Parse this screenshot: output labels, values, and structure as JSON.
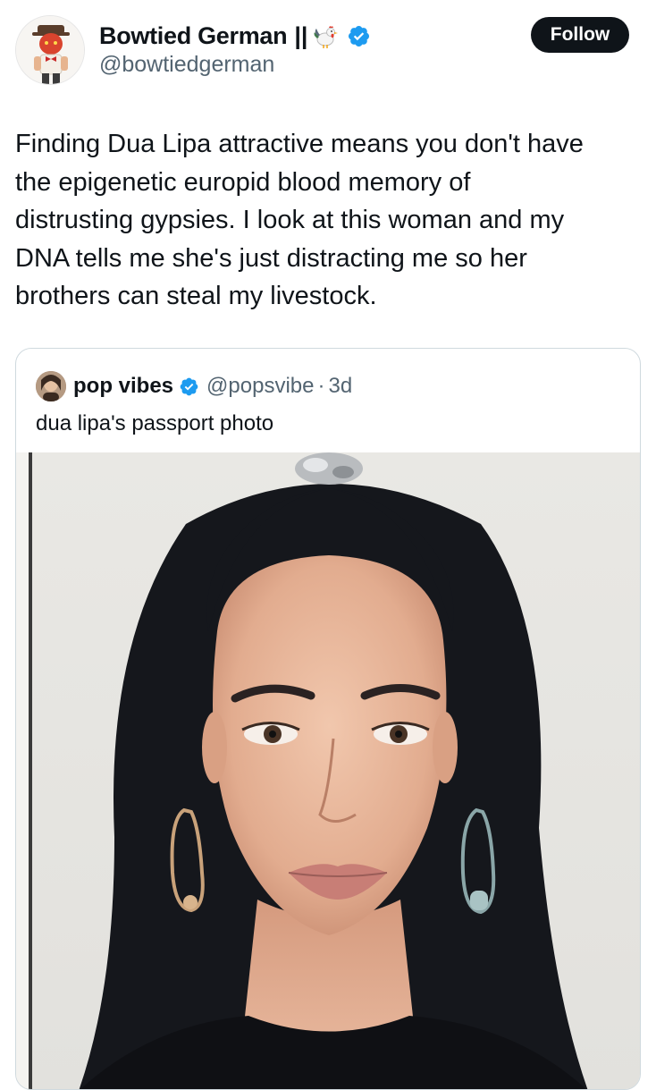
{
  "post": {
    "author": {
      "display_name": "Bowtied German",
      "name_separator": "||",
      "name_emoji": "rooster",
      "verified": true,
      "handle": "@bowtiedgerman",
      "avatar_icon": "cartoon-man-bowtie-avatar"
    },
    "follow_label": "Follow",
    "text_lines": [
      "Finding Dua Lipa attractive means you don't have",
      "the epigenetic europid blood memory of",
      "distrusting gypsies.  I look at this woman and my",
      "DNA tells me she's just distracting me so her",
      "brothers can steal my livestock."
    ]
  },
  "quote": {
    "author": {
      "display_name": "pop vibes",
      "verified": true,
      "handle": "@popsvibe",
      "separator": "·",
      "time": "3d"
    },
    "text": "dua lipa's passport photo",
    "media": "portrait-photo"
  },
  "colors": {
    "text_primary": "#0f1419",
    "text_secondary": "#536471",
    "verified_blue": "#1d9bf0",
    "follow_bg": "#0f1419",
    "border": "#cfd9de"
  }
}
